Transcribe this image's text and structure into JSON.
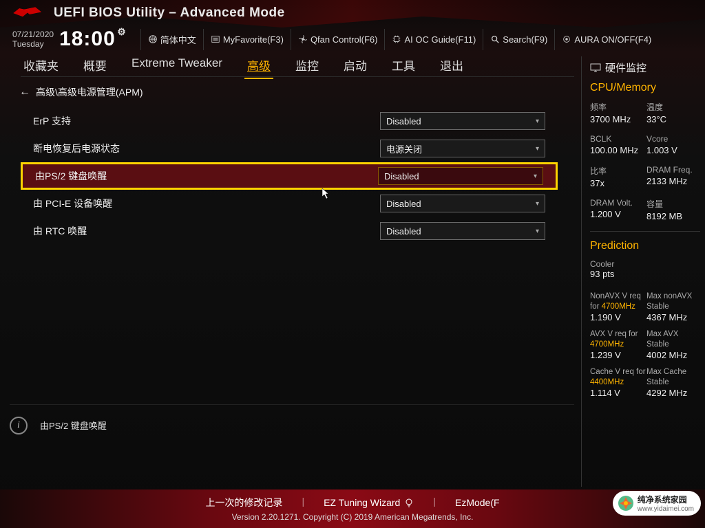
{
  "header": {
    "title": "UEFI BIOS Utility – Advanced Mode",
    "date": "07/21/2020",
    "weekday": "Tuesday",
    "time": "18:00"
  },
  "toolbar": {
    "language": "简体中文",
    "favorite": "MyFavorite(F3)",
    "qfan": "Qfan Control(F6)",
    "aioc": "AI OC Guide(F11)",
    "search": "Search(F9)",
    "aura": "AURA ON/OFF(F4)"
  },
  "tabs": [
    "收藏夹",
    "概要",
    "Extreme Tweaker",
    "高级",
    "监控",
    "启动",
    "工具",
    "退出"
  ],
  "active_tab": 3,
  "breadcrumb": "高级\\高级电源管理(APM)",
  "rows": [
    {
      "label": "ErP 支持",
      "value": "Disabled",
      "selected": false
    },
    {
      "label": "断电恢复后电源状态",
      "value": "电源关闭",
      "selected": false
    },
    {
      "label": "由PS/2 键盘唤醒",
      "value": "Disabled",
      "selected": true
    },
    {
      "label": "由 PCI-E 设备唤醒",
      "value": "Disabled",
      "selected": false
    },
    {
      "label": "由 RTC 唤醒",
      "value": "Disabled",
      "selected": false
    }
  ],
  "help_text": "由PS/2 键盘唤醒",
  "sidebar": {
    "header": "硬件监控",
    "cpu_mem_title": "CPU/Memory",
    "stats": [
      [
        {
          "label": "频率",
          "value": "3700 MHz"
        },
        {
          "label": "温度",
          "value": "33°C"
        }
      ],
      [
        {
          "label": "BCLK",
          "value": "100.00 MHz"
        },
        {
          "label": "Vcore",
          "value": "1.003 V"
        }
      ],
      [
        {
          "label": "比率",
          "value": "37x"
        },
        {
          "label": "DRAM Freq.",
          "value": "2133 MHz"
        }
      ],
      [
        {
          "label": "DRAM Volt.",
          "value": "1.200 V"
        },
        {
          "label": "容量",
          "value": "8192 MB"
        }
      ]
    ],
    "pred_title": "Prediction",
    "cooler_label": "Cooler",
    "cooler_value": "93 pts",
    "preds": [
      [
        {
          "label": "NonAVX V req for",
          "hl": "4700MHz",
          "value": "1.190 V"
        },
        {
          "label": "Max nonAVX Stable",
          "value": "4367 MHz"
        }
      ],
      [
        {
          "label": "AVX V req for",
          "hl": "4700MHz",
          "value": "1.239 V"
        },
        {
          "label": "Max AVX Stable",
          "value": "4002 MHz"
        }
      ],
      [
        {
          "label": "Cache V req for",
          "hl": "4400MHz",
          "value": "1.114 V"
        },
        {
          "label": "Max Cache Stable",
          "value": "4292 MHz"
        }
      ]
    ]
  },
  "footer": {
    "links": [
      "上一次的修改记录",
      "EZ Tuning Wizard",
      "EzMode(F"
    ],
    "copyright": "Version 2.20.1271. Copyright (C) 2019 American Megatrends, Inc."
  },
  "watermark": {
    "name": "纯净系统家园",
    "url": "www.yidaimei.com"
  }
}
